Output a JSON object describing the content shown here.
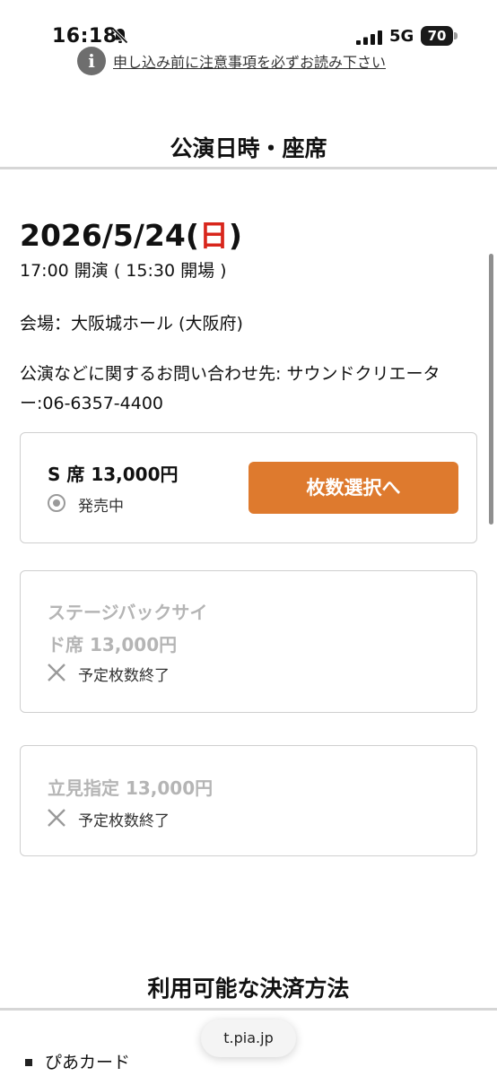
{
  "status_bar": {
    "time": "16:18",
    "network": "5G",
    "battery": "70"
  },
  "notice": {
    "icon": "i",
    "link_text": "申し込み前に注意事項を必ずお読み下さい"
  },
  "section": {
    "title": "公演日時・座席"
  },
  "performance": {
    "date_prefix": "2026/5/24(",
    "weekday": "日",
    "date_suffix": ")",
    "weekday_color": "#d8261c",
    "time_text": "17:00 開演 ( 15:30 開場 )",
    "venue_text": "会場：大阪城ホール (大阪府)",
    "contact_text": "公演などに関するお問い合わせ先: サウンドクリエーター:06-6357-4400"
  },
  "seats": [
    {
      "name": "S 席 13,000円",
      "status": "発売中",
      "status_icon": "radio-circle-icon",
      "button_label": "枚数選択へ",
      "available": true
    },
    {
      "name_line1": "ステージバックサイ",
      "name_line2": "ド席 13,000円",
      "status": "予定枚数終了",
      "status_icon": "cross-icon",
      "available": false
    },
    {
      "name": "立見指定 13,000円",
      "status": "予定枚数終了",
      "status_icon": "cross-icon",
      "available": false
    }
  ],
  "payment": {
    "title": "利用可能な決済方法",
    "items": [
      "ぴあカード"
    ]
  },
  "browser": {
    "url": "t.pia.jp"
  },
  "colors": {
    "accent": "#de7a2e",
    "sunday": "#d8261c",
    "disabled_text": "#b5b5b5"
  }
}
